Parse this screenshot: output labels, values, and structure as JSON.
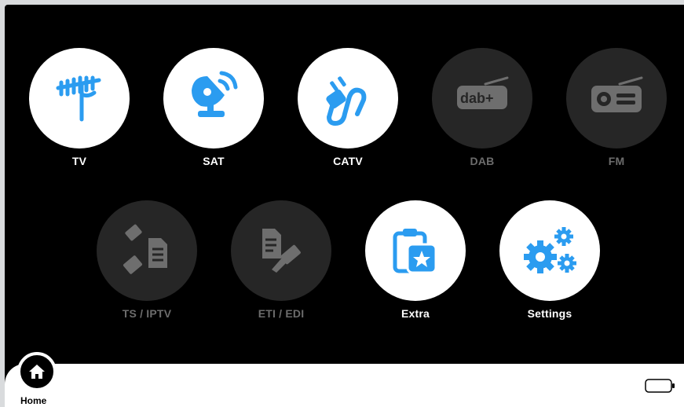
{
  "colors": {
    "accent": "#2b9cf0",
    "active_bg": "#ffffff",
    "inactive_bg": "#262626",
    "inactive_icon": "#6e6e6e"
  },
  "tiles": [
    {
      "label": "TV",
      "icon": "antenna-icon",
      "enabled": true
    },
    {
      "label": "SAT",
      "icon": "satellite-dish-icon",
      "enabled": true
    },
    {
      "label": "CATV",
      "icon": "cable-plug-icon",
      "enabled": true
    },
    {
      "label": "DAB",
      "icon": "dab-radio-icon",
      "enabled": false
    },
    {
      "label": "FM",
      "icon": "fm-radio-icon",
      "enabled": false
    },
    {
      "label": "TS / IPTV",
      "icon": "network-document-icon",
      "enabled": false
    },
    {
      "label": "ETI / EDI",
      "icon": "document-network-icon",
      "enabled": false
    },
    {
      "label": "Extra",
      "icon": "clipboard-star-icon",
      "enabled": true
    },
    {
      "label": "Settings",
      "icon": "gears-icon",
      "enabled": true
    }
  ],
  "footer": {
    "home_label": "Home",
    "home_icon": "home-icon",
    "battery_icon": "battery-icon"
  },
  "dab_logo_text": "dab+"
}
